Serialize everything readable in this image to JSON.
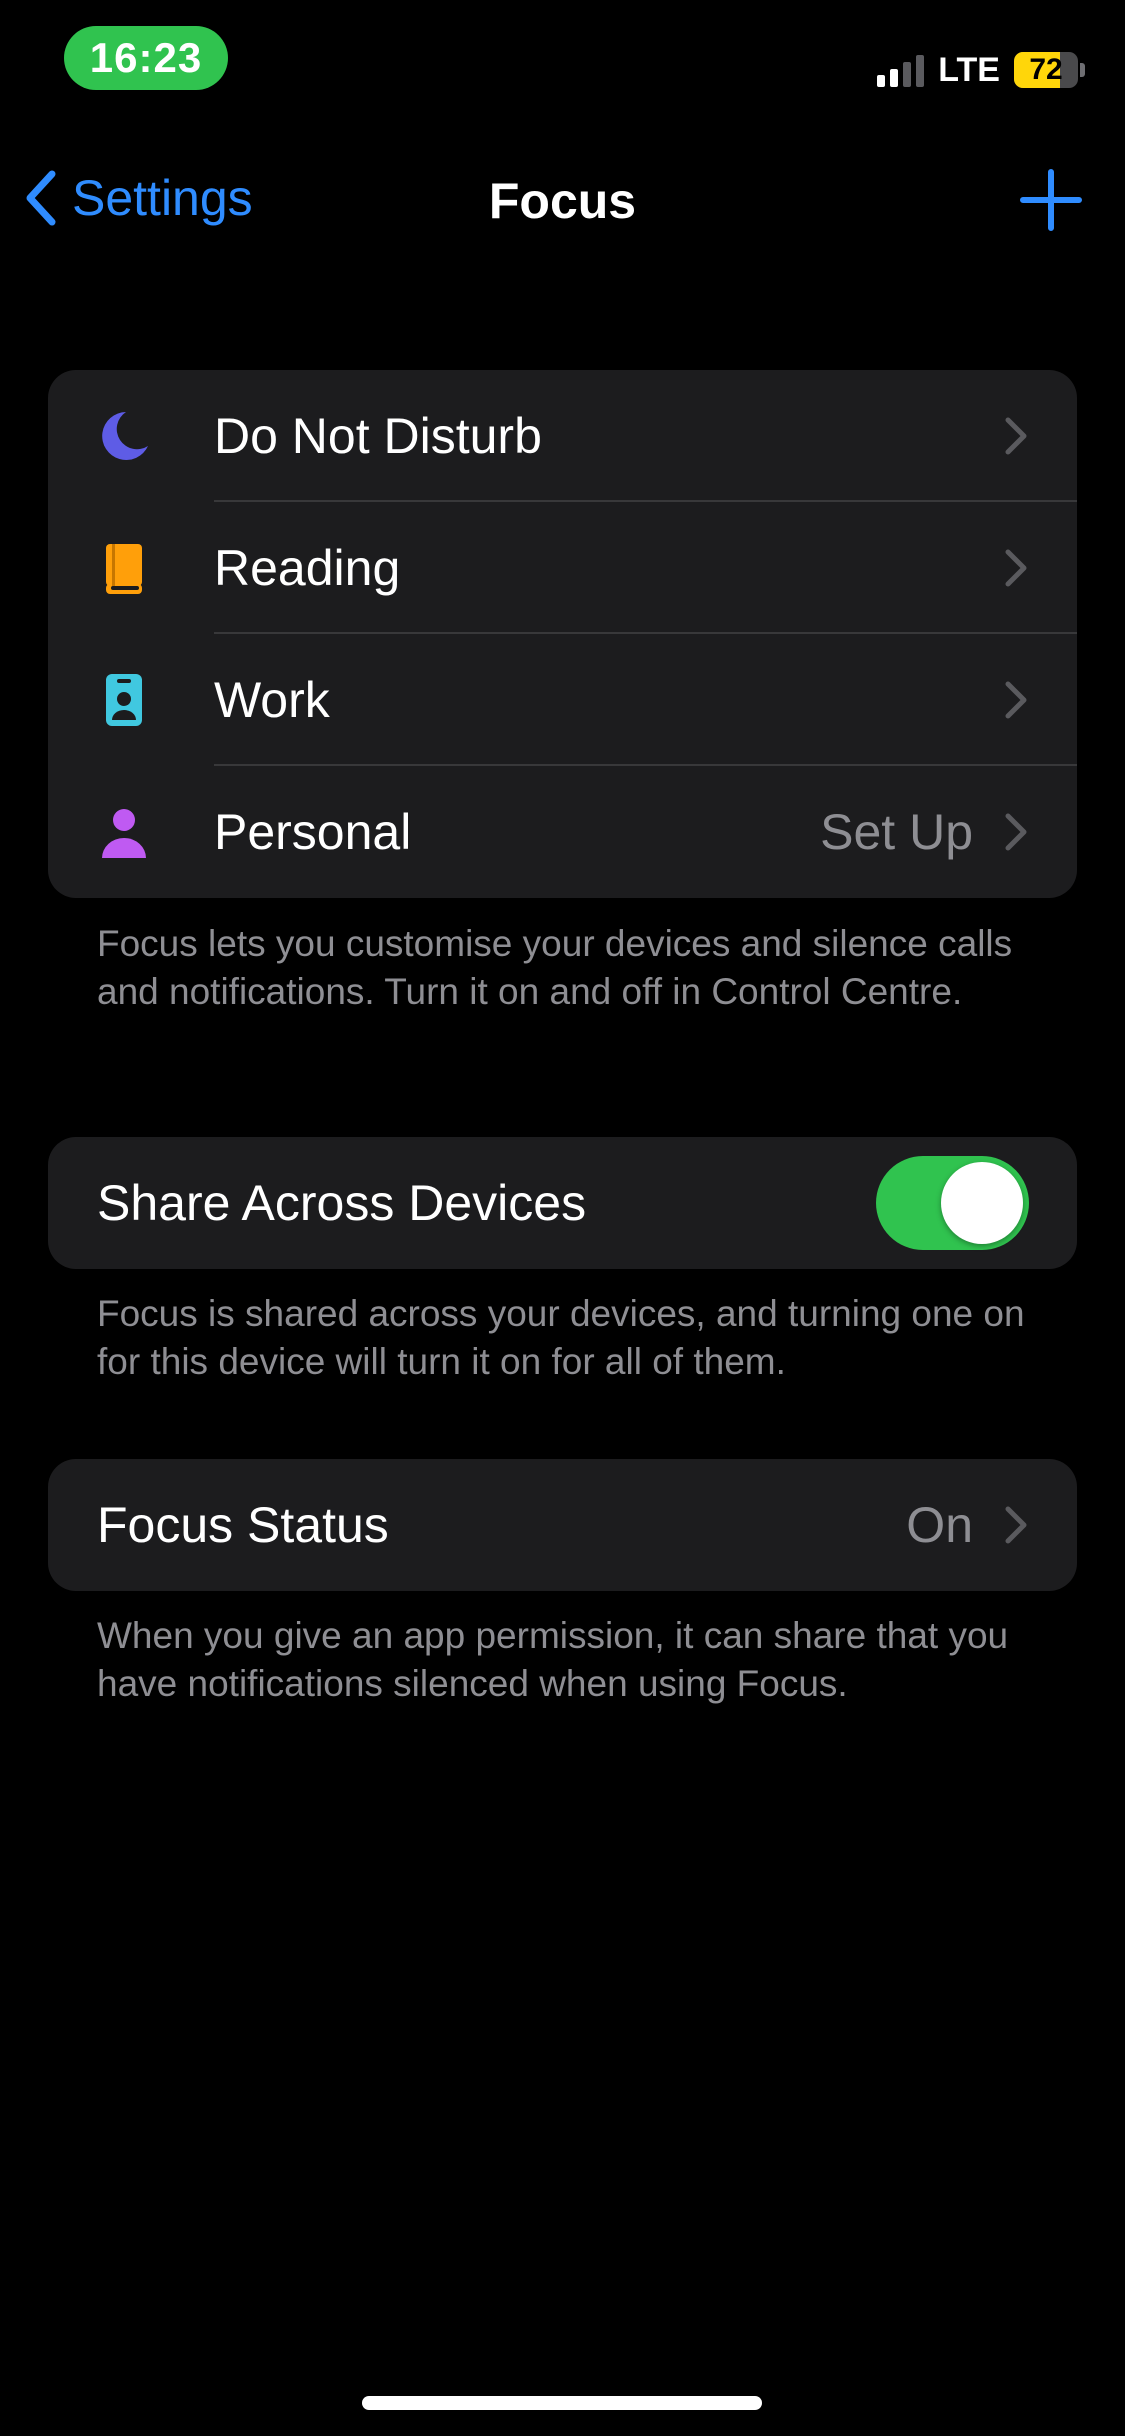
{
  "status_bar": {
    "time": "16:23",
    "network": "LTE",
    "battery_percent": "72",
    "battery_level": 0.72
  },
  "nav": {
    "back_label": "Settings",
    "title": "Focus",
    "add_icon": "plus-icon"
  },
  "focus_modes": [
    {
      "label": "Do Not Disturb",
      "icon": "moon-icon",
      "color": "#5e5ce6",
      "value": ""
    },
    {
      "label": "Reading",
      "icon": "book-icon",
      "color": "#ff9f0a",
      "value": ""
    },
    {
      "label": "Work",
      "icon": "id-badge-icon",
      "color": "#40c8e0",
      "value": ""
    },
    {
      "label": "Personal",
      "icon": "person-icon",
      "color": "#bf5af2",
      "value": "Set Up"
    }
  ],
  "focus_footer": "Focus lets you customise your devices and silence calls and notifications. Turn it on and off in Control Centre.",
  "share_across_devices": {
    "label": "Share Across Devices",
    "enabled": true,
    "footer": "Focus is shared across your devices, and turning one on for this device will turn it on for all of them."
  },
  "focus_status": {
    "label": "Focus Status",
    "value": "On",
    "footer": "When you give an app permission, it can share that you have notifications silenced when using Focus."
  },
  "colors": {
    "accent": "#2f8cff",
    "toggle_on": "#30c34f",
    "time_pill": "#30c34f",
    "battery": "#ffd60a"
  }
}
